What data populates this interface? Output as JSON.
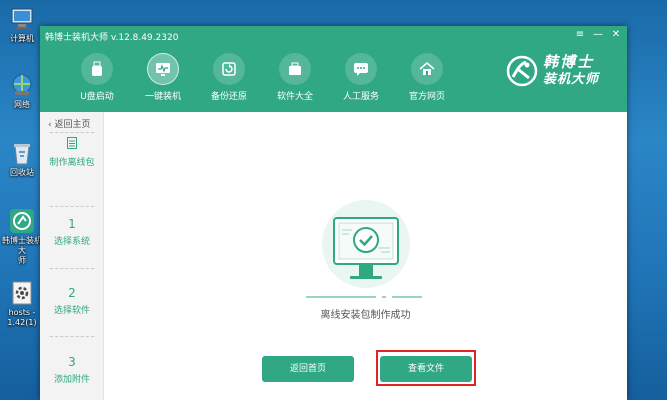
{
  "desktop": {
    "icons": [
      {
        "label": "计算机"
      },
      {
        "label": "网络"
      },
      {
        "label": "回收站"
      },
      {
        "label": "韩博士装机大\n师"
      },
      {
        "label": "hosts -\n1.42(1)"
      }
    ]
  },
  "window": {
    "title": "韩博士装机大师 v.12.8.49.2320",
    "controls": {
      "menu": "≡",
      "minimize": "—",
      "close": "✕"
    },
    "nav": [
      {
        "label": "U盘启动",
        "icon": "usb-icon"
      },
      {
        "label": "一键装机",
        "icon": "monitor-icon"
      },
      {
        "label": "备份还原",
        "icon": "backup-icon"
      },
      {
        "label": "软件大全",
        "icon": "briefcase-icon"
      },
      {
        "label": "人工服务",
        "icon": "chat-icon"
      },
      {
        "label": "官方网页",
        "icon": "home-icon"
      }
    ],
    "brand": {
      "line1": "韩博士",
      "line2": "装机大师"
    }
  },
  "sidebar": {
    "back": "返回主页",
    "steps": [
      {
        "num": "",
        "label": "制作离线包"
      },
      {
        "num": "1",
        "label": "选择系统"
      },
      {
        "num": "2",
        "label": "选择软件"
      },
      {
        "num": "3",
        "label": "添加附件"
      }
    ]
  },
  "main": {
    "success_message": "离线安装包制作成功",
    "buttons": {
      "back_home": "返回首页",
      "view_files": "查看文件"
    }
  },
  "colors": {
    "accent": "#2fa883",
    "highlight": "#e02424"
  }
}
